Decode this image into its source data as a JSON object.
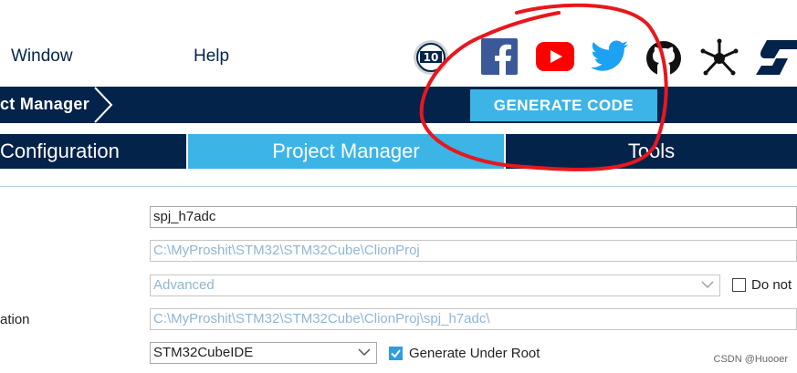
{
  "menu": {
    "window": "Window",
    "help": "Help"
  },
  "icons": [
    "anniversary-10-badge-icon",
    "facebook-icon",
    "youtube-icon",
    "twitter-icon",
    "github-icon",
    "network-share-icon",
    "st-logo-icon"
  ],
  "anniversary_badge": {
    "number": "10"
  },
  "breadcrumb": {
    "label": "ct Manager"
  },
  "toolbar": {
    "generate_label": "GENERATE CODE"
  },
  "tabs": {
    "configuration": "Configuration",
    "project_manager": "Project Manager",
    "tools": "Tools"
  },
  "form": {
    "project_name": "spj_h7adc",
    "project_location": "C:\\MyProshit\\STM32\\STM32Cube\\ClionProj",
    "application_structure": "Advanced",
    "do_not_label": "Do not",
    "toolchain_folder_label": "ation",
    "toolchain_folder": "C:\\MyProshit\\STM32\\STM32Cube\\ClionProj\\spj_h7adc\\",
    "toolchain_ide": "STM32CubeIDE",
    "generate_under_root_label": "Generate Under Root",
    "generate_under_root_checked": true,
    "do_not_checked": false
  },
  "watermark": "CSDN @Huooer",
  "colors": {
    "navy": "#03234b",
    "accent": "#3cb4e6",
    "annotation": "#e8171c"
  }
}
